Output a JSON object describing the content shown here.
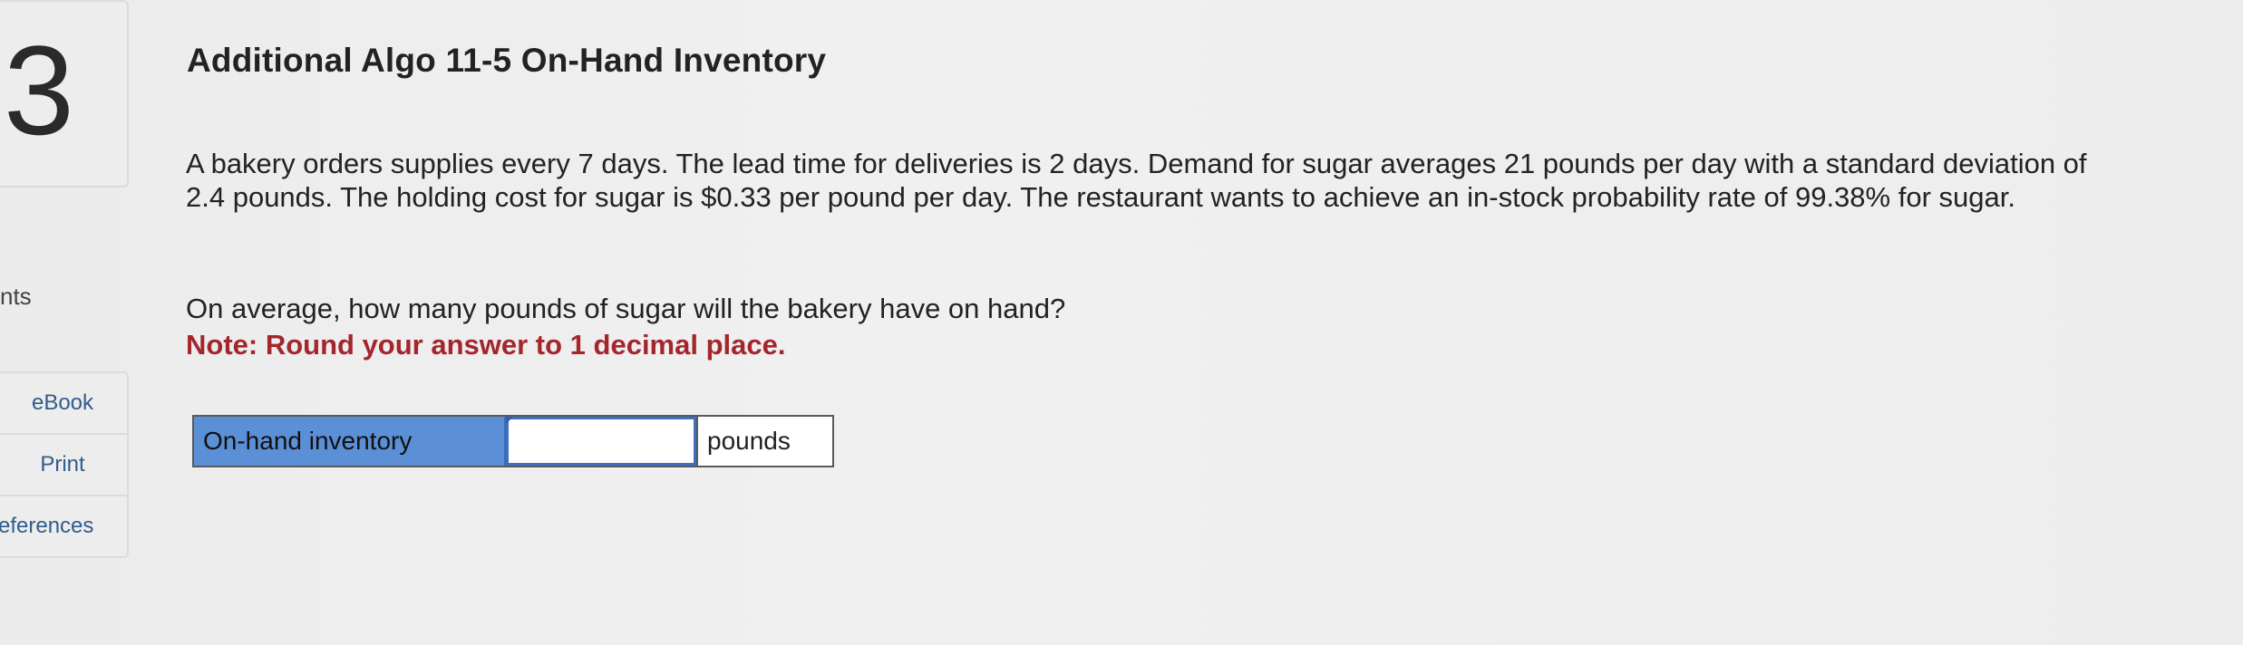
{
  "question": {
    "number": "3",
    "title": "Additional Algo 11-5 On-Hand Inventory",
    "prompt": "A bakery orders supplies every 7 days. The lead time for deliveries is 2 days. Demand for sugar averages 21 pounds per day with a standard deviation of 2.4 pounds. The holding cost for sugar is $0.33 per pound per day. The restaurant wants to achieve an in-stock probability rate of 99.38% for sugar.",
    "ask": "On average, how many pounds of sugar will the bakery have on hand?",
    "note": "Note: Round your answer to 1 decimal place."
  },
  "sidebar": {
    "points_label": "nts",
    "links": [
      {
        "label": "eBook"
      },
      {
        "label": "Print"
      },
      {
        "label": "eferences"
      }
    ]
  },
  "answer": {
    "label": "On-hand inventory",
    "value": "",
    "unit": "pounds"
  },
  "colors": {
    "label_bg": "#5b8fd6",
    "note_text": "#a4262c",
    "link_text": "#2f5d8c",
    "input_border": "#3b6fc4"
  }
}
